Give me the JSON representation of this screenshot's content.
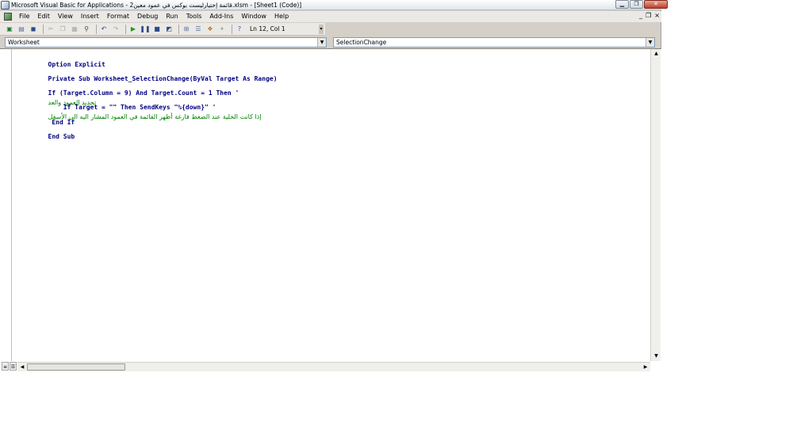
{
  "window": {
    "title": "Microsoft Visual Basic for Applications - قائمة إختيارليست بوكس في عمود معين2.xlsm - [Sheet1 (Code)]",
    "controls": {
      "minimize": "▁",
      "restore": "❐",
      "close": "✕"
    }
  },
  "menu": {
    "items": [
      "File",
      "Edit",
      "View",
      "Insert",
      "Format",
      "Debug",
      "Run",
      "Tools",
      "Add-Ins",
      "Window",
      "Help"
    ],
    "mdi_controls": {
      "minimize": "_",
      "restore": "❐",
      "close": "×"
    }
  },
  "toolbar": {
    "position_text": "Ln 12, Col 1",
    "icons": [
      "excel-icon",
      "insert-module-icon",
      "save-icon",
      "cut-icon",
      "copy-icon",
      "paste-icon",
      "find-icon",
      "undo-icon",
      "redo-icon",
      "run-icon",
      "break-icon",
      "reset-icon",
      "design-mode-icon",
      "project-explorer-icon",
      "properties-icon",
      "object-browser-icon",
      "toolbox-icon",
      "help-icon"
    ]
  },
  "object_combo": {
    "value": "Worksheet"
  },
  "procedure_combo": {
    "value": "SelectionChange"
  },
  "code": {
    "lines": [
      {
        "code": "Option Explicit",
        "comment": ""
      },
      {
        "code": "Private Sub Worksheet_SelectionChange(ByVal Target As Range)",
        "comment": ""
      },
      {
        "code": "If (Target.Column = 9) And Target.Count = 1 Then '",
        "comment": "تحديد العمود والعد"
      },
      {
        "code": "    If Target = \"\" Then SendKeys \"%{down}\" '",
        "comment": "إذا كانت الخلية عند الضغط فارغة أظهر القائمة في العمود المشار اليه الى الأسفل"
      },
      {
        "code": " End If",
        "comment": ""
      },
      {
        "code": "End Sub",
        "comment": ""
      }
    ]
  },
  "colors": {
    "keyword": "#000080",
    "comment": "#008000",
    "chrome": "#d4d0c8"
  }
}
